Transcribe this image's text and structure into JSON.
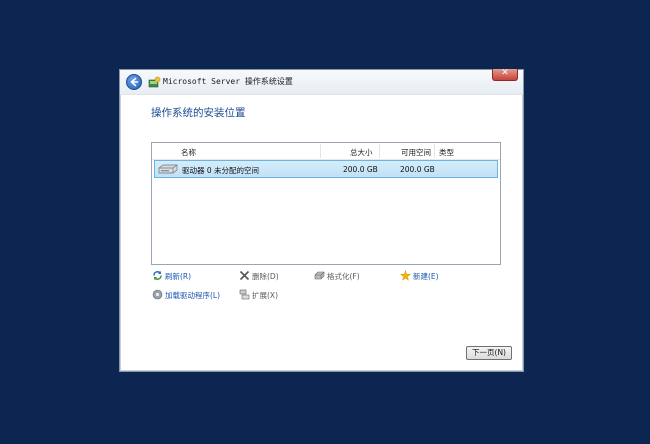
{
  "window": {
    "title": "Microsoft Server 操作系统设置",
    "close_label": "✕"
  },
  "heading": "操作系统的安装位置",
  "disk_list": {
    "columns": [
      "名称",
      "总大小",
      "可用空间",
      "类型"
    ],
    "rows": [
      {
        "name": "驱动器 0 未分配的空间",
        "total_size": "200.0 GB",
        "free_space": "200.0 GB",
        "type": ""
      }
    ]
  },
  "actions": {
    "refresh": "刷新(R)",
    "delete": "删除(D)",
    "format": "格式化(F)",
    "new": "新建(E)",
    "load_driver": "加载驱动程序(L)",
    "extend": "扩展(X)"
  },
  "next_button": "下一页(N)",
  "colors": {
    "desktop": "#0d2551",
    "heading": "#1d4b93",
    "link": "#1c57b1",
    "selection": "#bfe1f6"
  }
}
